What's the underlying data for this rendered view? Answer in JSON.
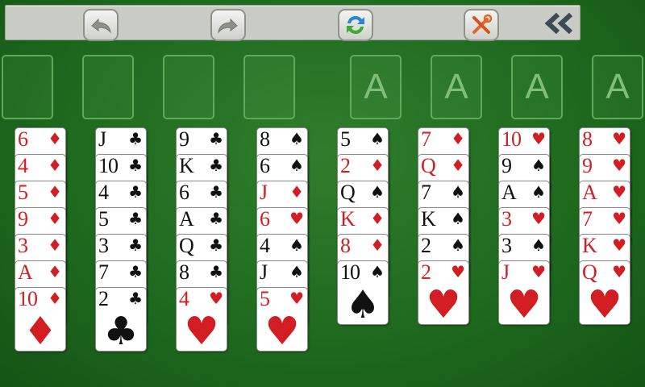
{
  "colors": {
    "felt": "#1f6a1f",
    "red_suit": "#d21e22",
    "black_suit": "#111111",
    "slot_outline": "#5fa95a"
  },
  "toolbar": {
    "undo_icon": "undo-arrow-icon",
    "redo_icon": "redo-arrow-icon",
    "restart_icon": "refresh-icon",
    "settings_icon": "tools-icon",
    "collapse_glyph": "«"
  },
  "free_cells": [
    "",
    "",
    "",
    ""
  ],
  "foundations": [
    {
      "label": "A"
    },
    {
      "label": "A"
    },
    {
      "label": "A"
    },
    {
      "label": "A"
    }
  ],
  "suit_glyphs": {
    "hearts": "♥",
    "diamonds": "♦",
    "clubs": "♣",
    "spades": "♠"
  },
  "tableau": [
    [
      {
        "rank": "6",
        "suit": "diamonds"
      },
      {
        "rank": "4",
        "suit": "diamonds"
      },
      {
        "rank": "5",
        "suit": "diamonds"
      },
      {
        "rank": "9",
        "suit": "diamonds"
      },
      {
        "rank": "3",
        "suit": "diamonds"
      },
      {
        "rank": "A",
        "suit": "diamonds"
      },
      {
        "rank": "10",
        "suit": "diamonds"
      }
    ],
    [
      {
        "rank": "J",
        "suit": "clubs"
      },
      {
        "rank": "10",
        "suit": "clubs"
      },
      {
        "rank": "4",
        "suit": "clubs"
      },
      {
        "rank": "5",
        "suit": "clubs"
      },
      {
        "rank": "3",
        "suit": "clubs"
      },
      {
        "rank": "7",
        "suit": "clubs"
      },
      {
        "rank": "2",
        "suit": "clubs"
      }
    ],
    [
      {
        "rank": "9",
        "suit": "clubs"
      },
      {
        "rank": "K",
        "suit": "clubs"
      },
      {
        "rank": "6",
        "suit": "clubs"
      },
      {
        "rank": "A",
        "suit": "clubs"
      },
      {
        "rank": "Q",
        "suit": "clubs"
      },
      {
        "rank": "8",
        "suit": "clubs"
      },
      {
        "rank": "4",
        "suit": "hearts"
      }
    ],
    [
      {
        "rank": "8",
        "suit": "spades"
      },
      {
        "rank": "6",
        "suit": "spades"
      },
      {
        "rank": "J",
        "suit": "diamonds"
      },
      {
        "rank": "6",
        "suit": "hearts"
      },
      {
        "rank": "4",
        "suit": "spades"
      },
      {
        "rank": "J",
        "suit": "spades"
      },
      {
        "rank": "5",
        "suit": "hearts"
      }
    ],
    [
      {
        "rank": "5",
        "suit": "spades"
      },
      {
        "rank": "2",
        "suit": "diamonds"
      },
      {
        "rank": "Q",
        "suit": "spades"
      },
      {
        "rank": "K",
        "suit": "diamonds"
      },
      {
        "rank": "8",
        "suit": "diamonds"
      },
      {
        "rank": "10",
        "suit": "spades"
      }
    ],
    [
      {
        "rank": "7",
        "suit": "diamonds"
      },
      {
        "rank": "Q",
        "suit": "diamonds"
      },
      {
        "rank": "7",
        "suit": "spades"
      },
      {
        "rank": "K",
        "suit": "spades"
      },
      {
        "rank": "2",
        "suit": "spades"
      },
      {
        "rank": "2",
        "suit": "hearts"
      }
    ],
    [
      {
        "rank": "10",
        "suit": "hearts"
      },
      {
        "rank": "9",
        "suit": "spades"
      },
      {
        "rank": "A",
        "suit": "spades"
      },
      {
        "rank": "3",
        "suit": "hearts"
      },
      {
        "rank": "3",
        "suit": "spades"
      },
      {
        "rank": "J",
        "suit": "hearts"
      }
    ],
    [
      {
        "rank": "8",
        "suit": "hearts"
      },
      {
        "rank": "9",
        "suit": "hearts"
      },
      {
        "rank": "A",
        "suit": "hearts"
      },
      {
        "rank": "7",
        "suit": "hearts"
      },
      {
        "rank": "K",
        "suit": "hearts"
      },
      {
        "rank": "Q",
        "suit": "hearts"
      }
    ]
  ]
}
